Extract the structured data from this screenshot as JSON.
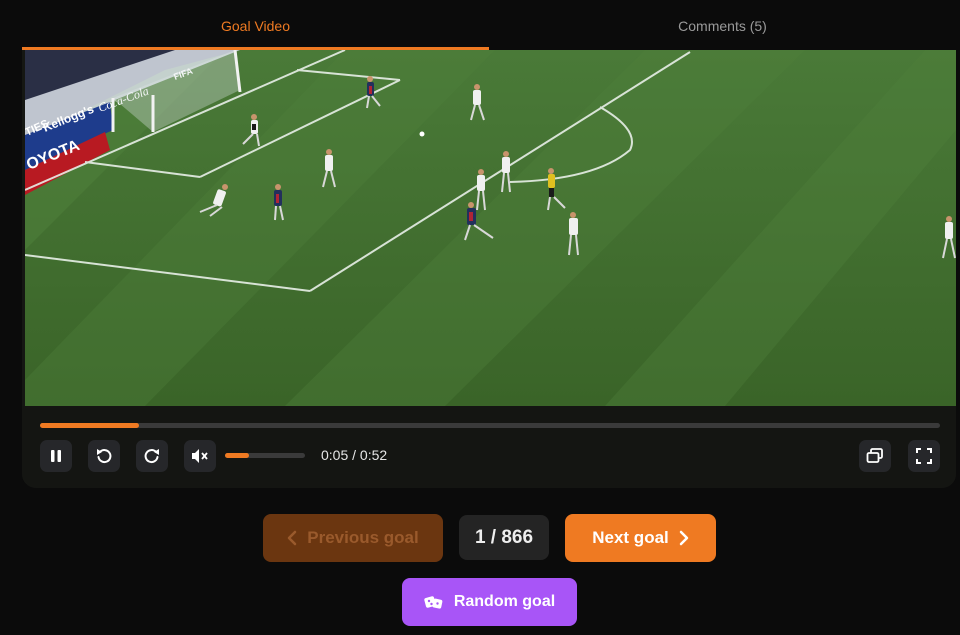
{
  "tabs": [
    {
      "label": "Goal Video",
      "active": true
    },
    {
      "label": "Comments (5)",
      "active": false
    }
  ],
  "player": {
    "current_time": "0:05",
    "duration": "0:52",
    "time_display": "0:05 / 0:52",
    "progress_fraction": 0.11,
    "volume_fraction": 0.3,
    "muted": true,
    "banner_texts": [
      "OYOTA",
      "Kellogg's",
      "Coca-Cola",
      "FIFA",
      "TIES"
    ]
  },
  "navigation": {
    "previous_label": "Previous goal",
    "counter": "1 / 866",
    "next_label": "Next goal",
    "random_label": "Random goal"
  },
  "colors": {
    "accent": "#ef7a22",
    "random": "#a855f7",
    "previous_disabled": "#6b3610",
    "background": "#0b0b0b"
  },
  "icons": [
    "pause-icon",
    "rewind-icon",
    "forward-icon",
    "mute-icon",
    "pip-icon",
    "fullscreen-icon",
    "chevron-left-icon",
    "chevron-right-icon",
    "dice-icon"
  ]
}
